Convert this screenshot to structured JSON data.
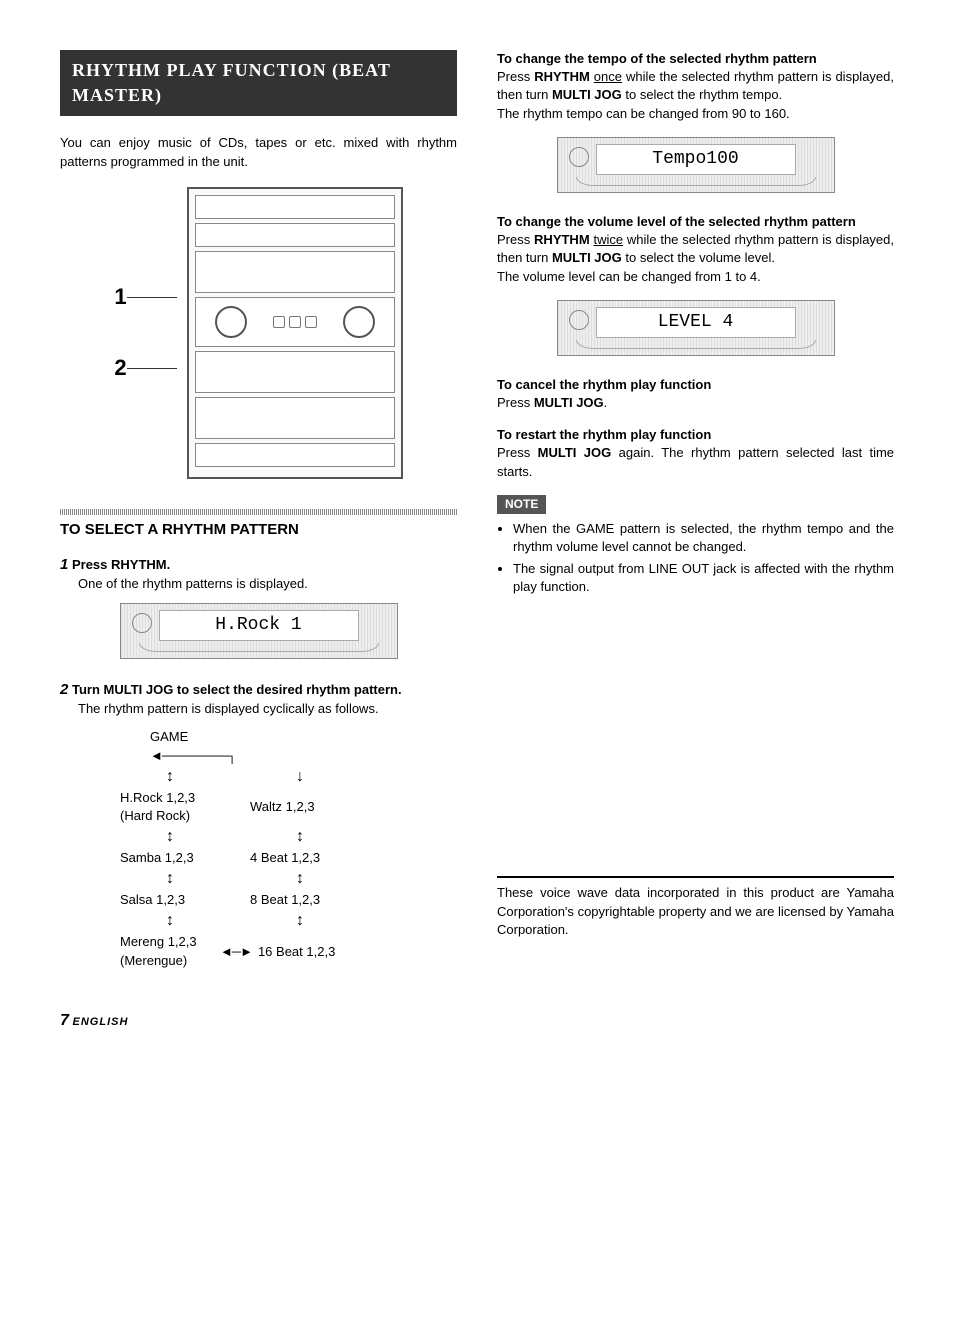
{
  "banner": "RHYTHM PLAY FUNCTION (BEAT MASTER)",
  "intro": "You can enjoy music of CDs, tapes or etc. mixed with rhythm patterns programmed in the unit.",
  "diagramLabels": {
    "one": "1",
    "two": "2"
  },
  "sectionHead": "TO SELECT A RHYTHM PATTERN",
  "step1": {
    "num": "1",
    "title": "Press RHYTHM.",
    "body": "One of the rhythm patterns is displayed.",
    "lcd": "H.Rock  1"
  },
  "step2": {
    "num": "2",
    "title": "Turn MULTI JOG to select the desired rhythm pattern.",
    "body": "The rhythm pattern is displayed cyclically as follows."
  },
  "cycle": {
    "game": "GAME",
    "hrock": "H.Rock 1,2,3",
    "hrockSub": "(Hard Rock)",
    "waltz": "Waltz 1,2,3",
    "samba": "Samba 1,2,3",
    "fourBeat": "4 Beat 1,2,3",
    "salsa": "Salsa 1,2,3",
    "eightBeat": "8 Beat 1,2,3",
    "mereng": "Mereng 1,2,3",
    "merengSub": "(Merengue)",
    "sixteenBeat": "16 Beat 1,2,3"
  },
  "tempo": {
    "head": "To change the tempo of the selected rhythm pattern",
    "p1a": "Press ",
    "p1b": "RHYTHM",
    "p1c": " ",
    "p1d": "once",
    "p1e": " while the selected rhythm pattern is displayed, then turn ",
    "p1f": "MULTI JOG",
    "p1g": " to select the rhythm tempo.",
    "p2": "The rhythm tempo can be changed from 90 to 160.",
    "lcd": "Tempo100"
  },
  "volume": {
    "head": "To change the volume level of the selected rhythm pattern",
    "p1a": "Press ",
    "p1b": "RHYTHM",
    "p1c": " ",
    "p1d": "twice",
    "p1e": " while the selected rhythm pattern is displayed, then turn ",
    "p1f": "MULTI JOG",
    "p1g": " to select the volume level.",
    "p2": "The volume level can be changed from 1 to 4.",
    "lcd": "LEVEL  4"
  },
  "cancel": {
    "head": "To cancel the rhythm play function",
    "b1a": "Press ",
    "b1b": "MULTI JOG",
    "b1c": "."
  },
  "restart": {
    "head": "To restart the rhythm play function",
    "b1a": "Press ",
    "b1b": "MULTI JOG",
    "b1c": " again. The rhythm pattern selected last time starts."
  },
  "noteLabel": "NOTE",
  "notes": [
    "When the GAME pattern is selected, the rhythm tempo and the rhythm volume level cannot be changed.",
    "The signal output from LINE OUT jack is affected with the rhythm play function."
  ],
  "footerNote": "These voice wave data incorporated in this product are Yamaha Corporation's copyrightable property and we are licensed by Yamaha Corporation.",
  "pageNum": "7",
  "pageLang": "ENGLISH"
}
